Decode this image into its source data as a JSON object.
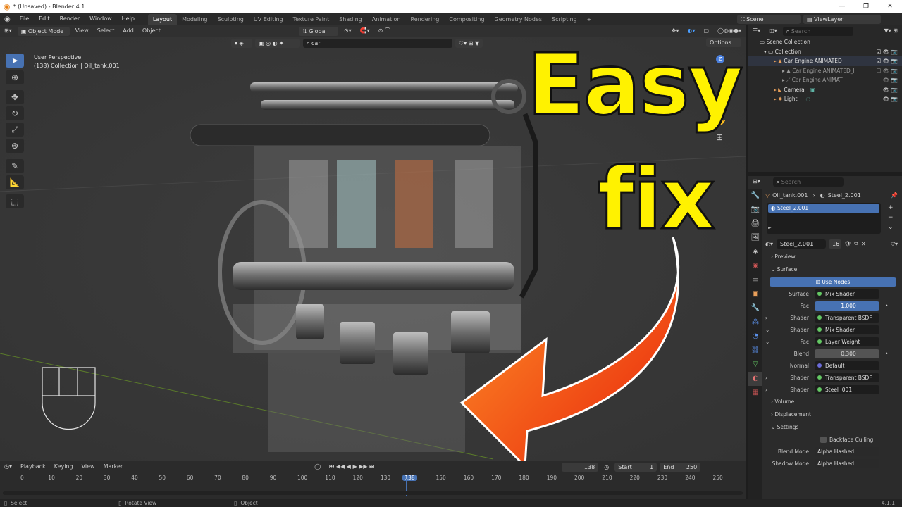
{
  "window": {
    "title": "* (Unsaved) - Blender 4.1",
    "controls": [
      "—",
      "❐",
      "✕"
    ]
  },
  "menus": [
    "File",
    "Edit",
    "Render",
    "Window",
    "Help"
  ],
  "workspaces": [
    "Layout",
    "Modeling",
    "Sculpting",
    "UV Editing",
    "Texture Paint",
    "Shading",
    "Animation",
    "Rendering",
    "Compositing",
    "Geometry Nodes",
    "Scripting"
  ],
  "active_workspace": "Layout",
  "scene": {
    "name": "Scene",
    "view_layer": "ViewLayer"
  },
  "viewport_header": {
    "mode": "Object Mode",
    "menus": [
      "View",
      "Select",
      "Add",
      "Object"
    ],
    "orientation": "Global",
    "search_value": "car",
    "options_label": "Options"
  },
  "viewport": {
    "perspective": "User Perspective",
    "collection_info": "(138) Collection | Oil_tank.001",
    "overlay_text": {
      "line1": "Easy",
      "line2": "fix"
    }
  },
  "outliner": {
    "search_placeholder": "Search",
    "items": [
      {
        "label": "Scene Collection",
        "indent": 0
      },
      {
        "label": "Collection",
        "indent": 1
      },
      {
        "label": "Car Engine ANIMATED",
        "indent": 2
      },
      {
        "label": "Car Engine ANIMATED_I",
        "indent": 3
      },
      {
        "label": "Car Engine ANIMAT",
        "indent": 3
      },
      {
        "label": "Camera",
        "indent": 2
      },
      {
        "label": "Light",
        "indent": 2
      }
    ]
  },
  "properties": {
    "search_placeholder": "Search",
    "breadcrumb": {
      "object": "Oil_tank.001",
      "material": "Steel_2.001"
    },
    "material_slot": "Steel_2.001",
    "material_name": "Steel_2.001",
    "user_count": "16",
    "sections": {
      "preview": "Preview",
      "surface": "Surface",
      "volume": "Volume",
      "displacement": "Displacement",
      "settings": "Settings"
    },
    "use_nodes_label": "Use Nodes",
    "surface_rows": [
      {
        "label": "Surface",
        "value": "Mix Shader",
        "kind": "socket"
      },
      {
        "label": "Fac",
        "value": "1.000",
        "kind": "blue"
      },
      {
        "label": "Shader",
        "value": "Transparent BSDF",
        "kind": "socket"
      },
      {
        "label": "Shader",
        "value": "Mix Shader",
        "kind": "socket"
      },
      {
        "label": "Fac",
        "value": "Layer Weight",
        "kind": "socket"
      },
      {
        "label": "Blend",
        "value": "0.300",
        "kind": "slider"
      },
      {
        "label": "Normal",
        "value": "Default",
        "kind": "socket-blue"
      },
      {
        "label": "Shader",
        "value": "Transparent BSDF",
        "kind": "socket"
      },
      {
        "label": "Shader",
        "value": "Steel .001",
        "kind": "socket"
      }
    ],
    "settings": {
      "backface_culling": "Backface Culling",
      "blend_mode_label": "Blend Mode",
      "blend_mode_value": "Alpha Hashed",
      "shadow_mode_label": "Shadow Mode",
      "shadow_mode_value": "Alpha Hashed"
    }
  },
  "timeline": {
    "menus": [
      "Playback",
      "Keying",
      "View",
      "Marker"
    ],
    "current_frame": "138",
    "start_label": "Start",
    "start_value": "1",
    "end_label": "End",
    "end_value": "250",
    "ticks": [
      "0",
      "10",
      "20",
      "30",
      "40",
      "50",
      "60",
      "70",
      "80",
      "90",
      "100",
      "110",
      "120",
      "130",
      "138",
      "150",
      "160",
      "170",
      "180",
      "190",
      "200",
      "210",
      "220",
      "230",
      "240",
      "250"
    ]
  },
  "statusbar": {
    "select": "Select",
    "rotate": "Rotate View",
    "object": "Object",
    "version": "4.1.1"
  }
}
